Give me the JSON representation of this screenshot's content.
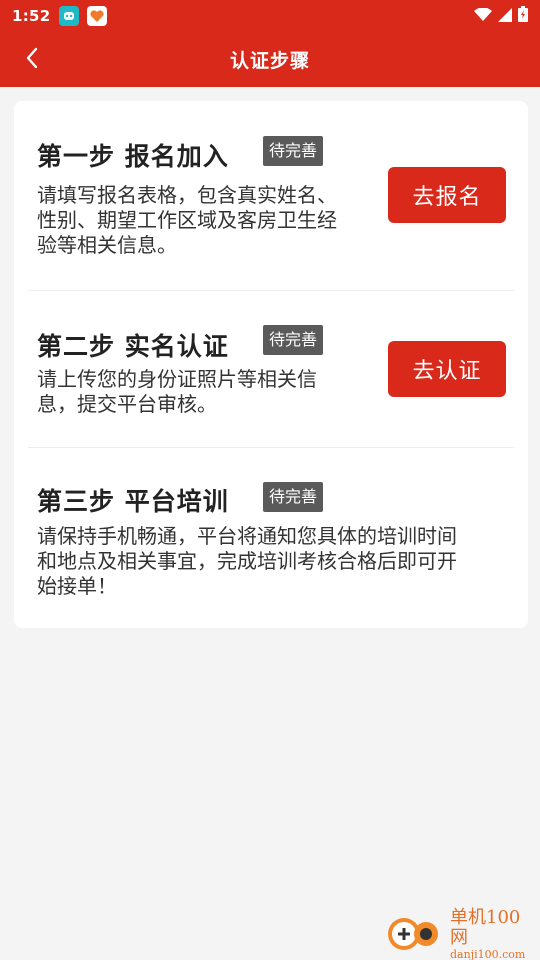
{
  "status_bar": {
    "time": "1:52"
  },
  "header": {
    "title": "认证步骤"
  },
  "steps": [
    {
      "title": "第一步 报名加入",
      "badge": "待完善",
      "desc_lines": [
        "请填写报名表格，包含真实姓名、",
        "性别、期望工作区域及客房卫生经",
        "验等相关信息。"
      ],
      "button": "去报名"
    },
    {
      "title": "第二步 实名认证",
      "badge": "待完善",
      "desc_lines": [
        "请上传您的身份证照片等相关信",
        "息，提交平台审核。"
      ],
      "button": "去认证"
    },
    {
      "title": "第三步 平台培训",
      "badge": "待完善",
      "desc_lines": [
        "请保持手机畅通，平台将通知您具体的培训时间",
        "和地点及相关事宜，完成培训考核合格后即可开",
        "始接单！"
      ]
    }
  ],
  "watermark": {
    "cn": "单机100网",
    "en": "danji100.com"
  },
  "colors": {
    "brand": "#d8291b",
    "badge": "#5a5a5a",
    "background": "#f4f4f4"
  }
}
